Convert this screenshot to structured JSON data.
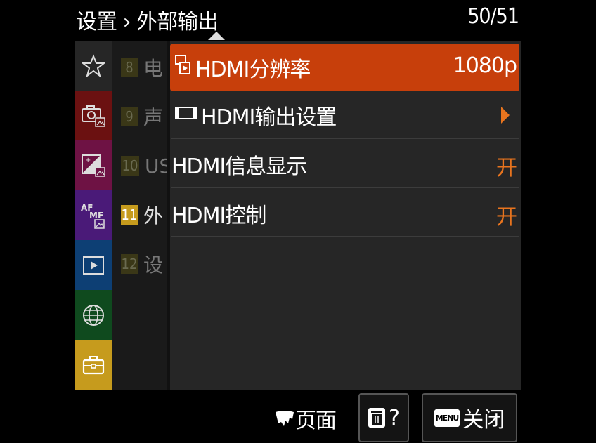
{
  "header": {
    "breadcrumb": "设置 › 外部输出",
    "pager": "50/51"
  },
  "categories": [
    {
      "name": "favorites",
      "icon": "star-icon",
      "color": "#262626"
    },
    {
      "name": "shooting",
      "icon": "camera-icon",
      "color": "#6b1111"
    },
    {
      "name": "exposure-color",
      "icon": "exposure-icon",
      "color": "#6e1244"
    },
    {
      "name": "focus",
      "icon": "af-mf-icon",
      "color": "#4a1a78"
    },
    {
      "name": "playback",
      "icon": "play-icon",
      "color": "#0d3f74"
    },
    {
      "name": "network",
      "icon": "globe-icon",
      "color": "#0f4a1e"
    },
    {
      "name": "setup",
      "icon": "toolbox-icon",
      "color": "#c69b1d"
    }
  ],
  "pages": [
    {
      "num": "8",
      "label": "电"
    },
    {
      "num": "9",
      "label": "声"
    },
    {
      "num": "10",
      "label": "US"
    },
    {
      "num": "11",
      "label": "外",
      "active": true
    },
    {
      "num": "12",
      "label": "设"
    }
  ],
  "menu": {
    "items": [
      {
        "label": "HDMI分辨率",
        "value": "1080p",
        "icon": "hdmi-resolution-icon"
      },
      {
        "label": "HDMI输出设置",
        "value": "",
        "icon": "film-strip-icon"
      },
      {
        "label": "HDMI信息显示",
        "value": "开"
      },
      {
        "label": "HDMI控制",
        "value": "开"
      }
    ]
  },
  "footer": {
    "page_label": "页面",
    "help_label": "?",
    "close_label": "关闭",
    "menu_badge": "MENU"
  }
}
